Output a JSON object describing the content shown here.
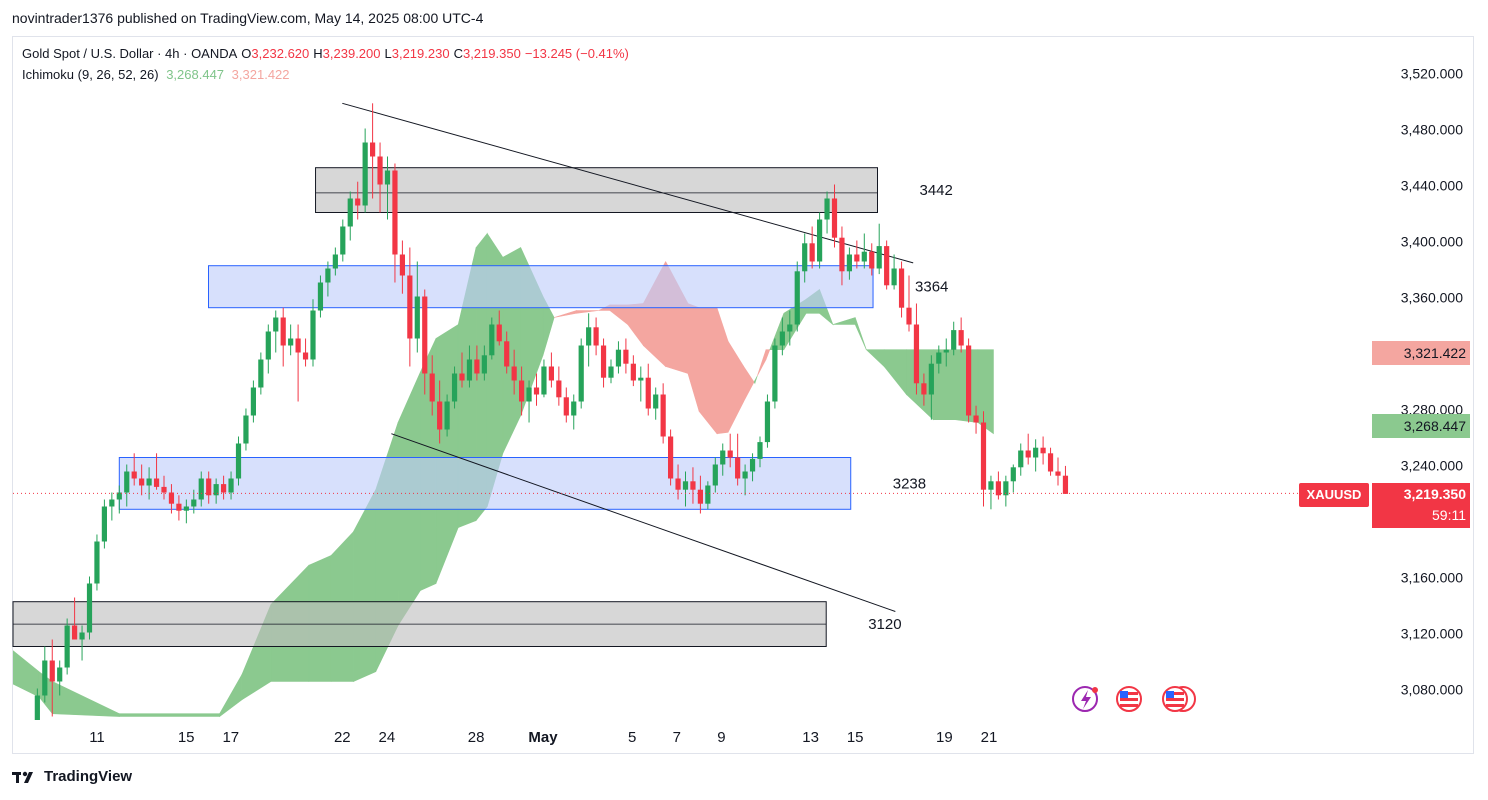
{
  "header": {
    "published": "novintrader1376 published on TradingView.com, May 14, 2025 08:00 UTC-4"
  },
  "legend": {
    "symbol": "Gold Spot / U.S. Dollar · 4h · OANDA",
    "open_label": "O",
    "open": "3,232.620",
    "high_label": "H",
    "high": "3,239.200",
    "low_label": "L",
    "low": "3,219.230",
    "close_label": "C",
    "close": "3,219.350",
    "change": "−13.245 (−0.41%)",
    "indicator": "Ichimoku (9, 26, 52, 26)",
    "ind_value_1": "3,268.447",
    "ind_value_2": "3,321.422"
  },
  "price_tags": {
    "symbol": "XAUUSD",
    "last_price": "3,219.350",
    "countdown": "59:11",
    "leading_span_b": "3,321.422",
    "leading_span_a": "3,268.447"
  },
  "footer": {
    "brand": "TradingView"
  },
  "colors": {
    "up": "#26a35a",
    "down": "#f23645",
    "cloud_bull": "#8bc98f",
    "cloud_bear": "#f4a6a0",
    "zone_blue": "#d4defc",
    "zone_gray": "#d3d3d3"
  },
  "chart_data": {
    "type": "candlestick",
    "symbol": "XAUUSD",
    "timeframe": "4h",
    "ylim": [
      3060,
      3540
    ],
    "yticks": [
      3080,
      3120,
      3160,
      3240,
      3280,
      3360,
      3400,
      3440,
      3480,
      3520
    ],
    "ytick_labels": [
      "3,080.000",
      "3,120.000",
      "3,160.000",
      "3,240.000",
      "3,280.000",
      "3,360.000",
      "3,400.000",
      "3,440.000",
      "3,480.000",
      "3,520.000"
    ],
    "xticks": [
      {
        "label": "11",
        "day": 11
      },
      {
        "label": "15",
        "day": 15
      },
      {
        "label": "17",
        "day": 17
      },
      {
        "label": "22",
        "day": 22
      },
      {
        "label": "24",
        "day": 24
      },
      {
        "label": "28",
        "day": 28
      },
      {
        "label": "May",
        "day": 31,
        "bold": true
      },
      {
        "label": "5",
        "day": 35
      },
      {
        "label": "7",
        "day": 37
      },
      {
        "label": "9",
        "day": 39
      },
      {
        "label": "13",
        "day": 43
      },
      {
        "label": "15",
        "day": 45
      },
      {
        "label": "19",
        "day": 49
      },
      {
        "label": "21",
        "day": 51
      }
    ],
    "candles": [
      [
        3008,
        3040,
        3000,
        3030
      ],
      [
        3030,
        3045,
        3010,
        3020
      ],
      [
        3020,
        3055,
        3015,
        3050
      ],
      [
        3050,
        3080,
        3045,
        3075
      ],
      [
        3075,
        3110,
        3070,
        3100
      ],
      [
        3100,
        3115,
        3060,
        3085
      ],
      [
        3085,
        3100,
        3075,
        3095
      ],
      [
        3095,
        3130,
        3090,
        3125
      ],
      [
        3125,
        3145,
        3120,
        3115
      ],
      [
        3115,
        3125,
        3100,
        3120
      ],
      [
        3120,
        3160,
        3115,
        3155
      ],
      [
        3155,
        3190,
        3150,
        3185
      ],
      [
        3185,
        3215,
        3180,
        3210
      ],
      [
        3210,
        3220,
        3200,
        3215
      ],
      [
        3215,
        3225,
        3205,
        3220
      ],
      [
        3220,
        3240,
        3210,
        3235
      ],
      [
        3235,
        3248,
        3225,
        3230
      ],
      [
        3230,
        3240,
        3218,
        3225
      ],
      [
        3225,
        3238,
        3215,
        3230
      ],
      [
        3230,
        3248,
        3222,
        3224
      ],
      [
        3224,
        3232,
        3215,
        3220
      ],
      [
        3220,
        3226,
        3205,
        3212
      ],
      [
        3212,
        3218,
        3200,
        3207
      ],
      [
        3207,
        3215,
        3198,
        3210
      ],
      [
        3210,
        3222,
        3205,
        3215
      ],
      [
        3215,
        3235,
        3210,
        3230
      ],
      [
        3230,
        3235,
        3212,
        3218
      ],
      [
        3218,
        3230,
        3212,
        3226
      ],
      [
        3226,
        3232,
        3215,
        3220
      ],
      [
        3220,
        3235,
        3215,
        3230
      ],
      [
        3230,
        3260,
        3225,
        3255
      ],
      [
        3255,
        3280,
        3250,
        3275
      ],
      [
        3275,
        3300,
        3270,
        3295
      ],
      [
        3295,
        3320,
        3290,
        3315
      ],
      [
        3315,
        3340,
        3305,
        3335
      ],
      [
        3335,
        3350,
        3320,
        3345
      ],
      [
        3345,
        3352,
        3310,
        3325
      ],
      [
        3325,
        3340,
        3318,
        3330
      ],
      [
        3330,
        3340,
        3285,
        3320
      ],
      [
        3320,
        3330,
        3310,
        3315
      ],
      [
        3315,
        3358,
        3310,
        3350
      ],
      [
        3350,
        3375,
        3345,
        3370
      ],
      [
        3370,
        3385,
        3360,
        3380
      ],
      [
        3380,
        3395,
        3375,
        3390
      ],
      [
        3390,
        3415,
        3385,
        3410
      ],
      [
        3410,
        3435,
        3400,
        3430
      ],
      [
        3430,
        3442,
        3415,
        3425
      ],
      [
        3425,
        3480,
        3420,
        3470
      ],
      [
        3470,
        3498,
        3430,
        3460
      ],
      [
        3460,
        3470,
        3420,
        3440
      ],
      [
        3440,
        3460,
        3415,
        3450
      ],
      [
        3450,
        3455,
        3370,
        3390
      ],
      [
        3390,
        3400,
        3362,
        3375
      ],
      [
        3375,
        3395,
        3310,
        3330
      ],
      [
        3330,
        3385,
        3320,
        3360
      ],
      [
        3360,
        3365,
        3290,
        3305
      ],
      [
        3305,
        3318,
        3275,
        3285
      ],
      [
        3285,
        3300,
        3255,
        3265
      ],
      [
        3265,
        3290,
        3260,
        3285
      ],
      [
        3285,
        3310,
        3280,
        3305
      ],
      [
        3305,
        3320,
        3295,
        3300
      ],
      [
        3300,
        3325,
        3295,
        3315
      ],
      [
        3315,
        3325,
        3300,
        3305
      ],
      [
        3305,
        3325,
        3300,
        3318
      ],
      [
        3318,
        3345,
        3315,
        3340
      ],
      [
        3340,
        3350,
        3325,
        3328
      ],
      [
        3328,
        3335,
        3305,
        3310
      ],
      [
        3310,
        3322,
        3290,
        3300
      ],
      [
        3300,
        3310,
        3275,
        3285
      ],
      [
        3285,
        3300,
        3270,
        3295
      ],
      [
        3295,
        3305,
        3282,
        3290
      ],
      [
        3290,
        3315,
        3288,
        3310
      ],
      [
        3310,
        3320,
        3295,
        3300
      ],
      [
        3300,
        3310,
        3282,
        3288
      ],
      [
        3288,
        3295,
        3270,
        3275
      ],
      [
        3275,
        3290,
        3265,
        3285
      ],
      [
        3285,
        3330,
        3280,
        3325
      ],
      [
        3325,
        3348,
        3310,
        3338
      ],
      [
        3338,
        3345,
        3318,
        3325
      ],
      [
        3325,
        3330,
        3295,
        3302
      ],
      [
        3302,
        3315,
        3298,
        3310
      ],
      [
        3310,
        3328,
        3305,
        3322
      ],
      [
        3322,
        3330,
        3305,
        3312
      ],
      [
        3312,
        3318,
        3296,
        3300
      ],
      [
        3300,
        3310,
        3285,
        3302
      ],
      [
        3302,
        3312,
        3275,
        3280
      ],
      [
        3280,
        3295,
        3272,
        3290
      ],
      [
        3290,
        3298,
        3255,
        3260
      ],
      [
        3260,
        3265,
        3225,
        3230
      ],
      [
        3230,
        3240,
        3215,
        3222
      ],
      [
        3222,
        3235,
        3210,
        3228
      ],
      [
        3228,
        3238,
        3212,
        3222
      ],
      [
        3222,
        3232,
        3205,
        3212
      ],
      [
        3212,
        3228,
        3208,
        3225
      ],
      [
        3225,
        3245,
        3220,
        3240
      ],
      [
        3240,
        3255,
        3232,
        3250
      ],
      [
        3250,
        3262,
        3238,
        3245
      ],
      [
        3245,
        3262,
        3225,
        3230
      ],
      [
        3230,
        3240,
        3218,
        3235
      ],
      [
        3235,
        3248,
        3228,
        3244
      ],
      [
        3244,
        3260,
        3238,
        3256
      ],
      [
        3256,
        3290,
        3252,
        3285
      ],
      [
        3285,
        3330,
        3280,
        3325
      ],
      [
        3325,
        3345,
        3318,
        3335
      ],
      [
        3335,
        3350,
        3325,
        3340
      ],
      [
        3340,
        3385,
        3335,
        3378
      ],
      [
        3378,
        3405,
        3370,
        3398
      ],
      [
        3398,
        3410,
        3380,
        3385
      ],
      [
        3385,
        3420,
        3380,
        3415
      ],
      [
        3415,
        3435,
        3405,
        3430
      ],
      [
        3430,
        3440,
        3395,
        3402
      ],
      [
        3402,
        3410,
        3368,
        3378
      ],
      [
        3378,
        3395,
        3372,
        3390
      ],
      [
        3390,
        3400,
        3380,
        3385
      ],
      [
        3385,
        3405,
        3380,
        3392
      ],
      [
        3392,
        3398,
        3375,
        3380
      ],
      [
        3380,
        3412,
        3376,
        3396
      ],
      [
        3396,
        3400,
        3365,
        3368
      ],
      [
        3368,
        3390,
        3365,
        3380
      ],
      [
        3380,
        3385,
        3345,
        3352
      ],
      [
        3352,
        3375,
        3335,
        3340
      ],
      [
        3340,
        3355,
        3290,
        3298
      ],
      [
        3298,
        3305,
        3282,
        3290
      ],
      [
        3290,
        3318,
        3272,
        3312
      ],
      [
        3312,
        3325,
        3305,
        3320
      ],
      [
        3320,
        3330,
        3310,
        3322
      ],
      [
        3322,
        3342,
        3318,
        3336
      ],
      [
        3336,
        3345,
        3320,
        3325
      ],
      [
        3325,
        3330,
        3270,
        3275
      ],
      [
        3275,
        3282,
        3262,
        3270
      ],
      [
        3270,
        3278,
        3210,
        3222
      ],
      [
        3222,
        3232,
        3208,
        3228
      ],
      [
        3228,
        3235,
        3215,
        3218
      ],
      [
        3218,
        3232,
        3210,
        3228
      ],
      [
        3228,
        3240,
        3220,
        3238
      ],
      [
        3238,
        3255,
        3232,
        3250
      ],
      [
        3250,
        3262,
        3240,
        3245
      ],
      [
        3245,
        3258,
        3235,
        3252
      ],
      [
        3252,
        3260,
        3240,
        3248
      ],
      [
        3248,
        3252,
        3232,
        3235
      ],
      [
        3235,
        3245,
        3225,
        3232
      ],
      [
        3232,
        3239,
        3219,
        3219
      ]
    ],
    "trendlines": [
      {
        "from": [
          22.0,
          3498
        ],
        "to": [
          47.6,
          3384
        ]
      },
      {
        "from": [
          24.2,
          3262
        ],
        "to": [
          46.8,
          3135
        ]
      }
    ],
    "zones": [
      {
        "label": "3442",
        "from_day": 20.8,
        "to_day": 46.0,
        "top": 3452,
        "bottom": 3420,
        "mid": 3434,
        "color": "gray"
      },
      {
        "label": "3364",
        "from_day": 16.0,
        "to_day": 45.8,
        "top": 3382,
        "bottom": 3352,
        "color": "blue"
      },
      {
        "label": "3238",
        "from_day": 12.0,
        "to_day": 44.8,
        "top": 3245,
        "bottom": 3208,
        "color": "blue"
      },
      {
        "label": "3120",
        "from_day": 7.0,
        "to_day": 43.7,
        "top": 3142,
        "bottom": 3110,
        "mid": 3126,
        "color": "gray"
      }
    ],
    "ichimoku": {
      "params": "9, 26, 52, 26",
      "span_a_last": 3268.447,
      "span_b_last": 3321.422,
      "cloud": [
        {
          "day": 7.0,
          "a": 3110,
          "b": 3085
        },
        {
          "day": 8.4,
          "a": 3092,
          "b": 3074
        },
        {
          "day": 9.0,
          "a": 3085,
          "b": 3062
        },
        {
          "day": 12.0,
          "a": 3062,
          "b": 3060
        },
        {
          "day": 16.5,
          "a": 3062,
          "b": 3060
        },
        {
          "day": 17.5,
          "a": 3090,
          "b": 3072
        },
        {
          "day": 18.8,
          "a": 3140,
          "b": 3085
        },
        {
          "day": 20.5,
          "a": 3168,
          "b": 3085
        },
        {
          "day": 21.5,
          "a": 3175,
          "b": 3085
        },
        {
          "day": 22.5,
          "a": 3192,
          "b": 3085
        },
        {
          "day": 23.5,
          "a": 3222,
          "b": 3092
        },
        {
          "day": 24.5,
          "a": 3270,
          "b": 3125
        },
        {
          "day": 25.5,
          "a": 3306,
          "b": 3150
        },
        {
          "day": 26.2,
          "a": 3330,
          "b": 3155
        },
        {
          "day": 27.2,
          "a": 3340,
          "b": 3195
        },
        {
          "day": 28.0,
          "a": 3395,
          "b": 3200
        },
        {
          "day": 28.5,
          "a": 3405,
          "b": 3210
        },
        {
          "day": 29.2,
          "a": 3388,
          "b": 3248
        },
        {
          "day": 30.0,
          "a": 3395,
          "b": 3275
        },
        {
          "day": 31.0,
          "a": 3360,
          "b": 3318
        },
        {
          "day": 31.5,
          "a": 3345,
          "b": 3345
        },
        {
          "day": 32.5,
          "a": 3348,
          "b": 3350
        },
        {
          "day": 33.5,
          "a": 3350,
          "b": 3350
        },
        {
          "day": 34.0,
          "a": 3350,
          "b": 3354
        },
        {
          "day": 34.8,
          "a": 3340,
          "b": 3354
        },
        {
          "day": 35.5,
          "a": 3325,
          "b": 3355
        },
        {
          "day": 36.5,
          "a": 3310,
          "b": 3385
        },
        {
          "day": 37.5,
          "a": 3305,
          "b": 3355
        },
        {
          "day": 38.0,
          "a": 3278,
          "b": 3352
        },
        {
          "day": 38.8,
          "a": 3262,
          "b": 3352
        },
        {
          "day": 39.3,
          "a": 3263,
          "b": 3328
        },
        {
          "day": 40.0,
          "a": 3285,
          "b": 3310
        },
        {
          "day": 40.5,
          "a": 3300,
          "b": 3298
        },
        {
          "day": 41.0,
          "a": 3315,
          "b": 3322
        },
        {
          "day": 41.8,
          "a": 3348,
          "b": 3322
        },
        {
          "day": 42.8,
          "a": 3358,
          "b": 3348
        },
        {
          "day": 43.4,
          "a": 3365,
          "b": 3348
        },
        {
          "day": 44.0,
          "a": 3340,
          "b": 3340
        },
        {
          "day": 45.0,
          "a": 3345,
          "b": 3340
        },
        {
          "day": 45.5,
          "a": 3322,
          "b": 3322
        },
        {
          "day": 46.3,
          "a": 3322,
          "b": 3310
        },
        {
          "day": 47.3,
          "a": 3322,
          "b": 3290
        },
        {
          "day": 48.5,
          "a": 3322,
          "b": 3272
        },
        {
          "day": 49.5,
          "a": 3322,
          "b": 3272
        },
        {
          "day": 50.5,
          "a": 3322,
          "b": 3270
        },
        {
          "day": 51.2,
          "a": 3322,
          "b": 3262
        }
      ]
    },
    "annotations": [
      "3442",
      "3364",
      "3238",
      "3120"
    ]
  }
}
